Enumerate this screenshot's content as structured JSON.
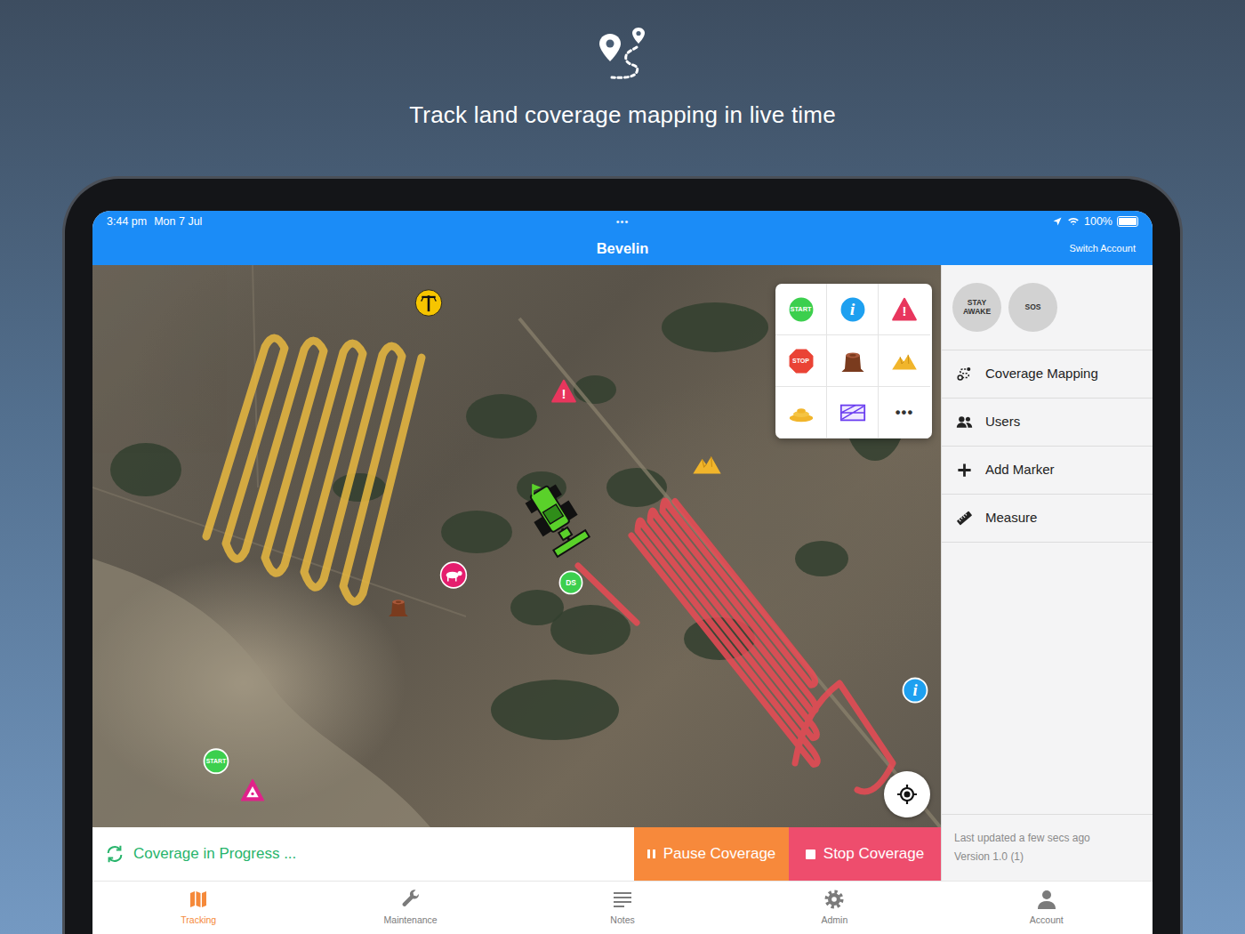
{
  "hero": {
    "headline": "Track land coverage mapping in live time"
  },
  "status_bar": {
    "time": "3:44 pm",
    "date": "Mon 7 Jul",
    "handle": "•••",
    "battery": "100%",
    "battery_level": 1
  },
  "header": {
    "title": "Bevelin",
    "switch_account": "Switch Account"
  },
  "map": {
    "tracks": [
      {
        "color": "#e9b83f"
      },
      {
        "color": "#ea4a55"
      }
    ],
    "markers": [
      {
        "kind": "power"
      },
      {
        "kind": "warning",
        "label": "!"
      },
      {
        "kind": "hill"
      },
      {
        "kind": "tractor"
      },
      {
        "kind": "ds",
        "label": "DS"
      },
      {
        "kind": "cow"
      },
      {
        "kind": "stump"
      },
      {
        "kind": "info",
        "label": "i"
      },
      {
        "kind": "start",
        "label": "START"
      },
      {
        "kind": "hazard"
      }
    ],
    "palette": [
      {
        "kind": "start",
        "label": "START"
      },
      {
        "kind": "info",
        "label": "i"
      },
      {
        "kind": "warning",
        "label": "!"
      },
      {
        "kind": "stop",
        "label": "STOP"
      },
      {
        "kind": "stump"
      },
      {
        "kind": "hill"
      },
      {
        "kind": "hay"
      },
      {
        "kind": "fence"
      },
      {
        "kind": "more",
        "label": "•••"
      }
    ]
  },
  "quick_actions": [
    {
      "label": "STAY AWAKE"
    },
    {
      "label": "SOS"
    }
  ],
  "menu": [
    {
      "kind": "coverage",
      "label": "Coverage Mapping"
    },
    {
      "kind": "users",
      "label": "Users"
    },
    {
      "kind": "add",
      "label": "Add Marker"
    },
    {
      "kind": "measure",
      "label": "Measure"
    }
  ],
  "coverage": {
    "status": "Coverage in Progress ...",
    "pause": "Pause Coverage",
    "stop": "Stop Coverage"
  },
  "sync": {
    "updated": "Last updated a few secs ago",
    "version": "Version 1.0 (1)"
  },
  "tabs": [
    {
      "label": "Tracking",
      "kind": "map",
      "selected": true
    },
    {
      "label": "Maintenance",
      "kind": "wrench",
      "selected": false
    },
    {
      "label": "Notes",
      "kind": "notes",
      "selected": false
    },
    {
      "label": "Admin",
      "kind": "gear",
      "selected": false
    },
    {
      "label": "Account",
      "kind": "person",
      "selected": false
    }
  ]
}
